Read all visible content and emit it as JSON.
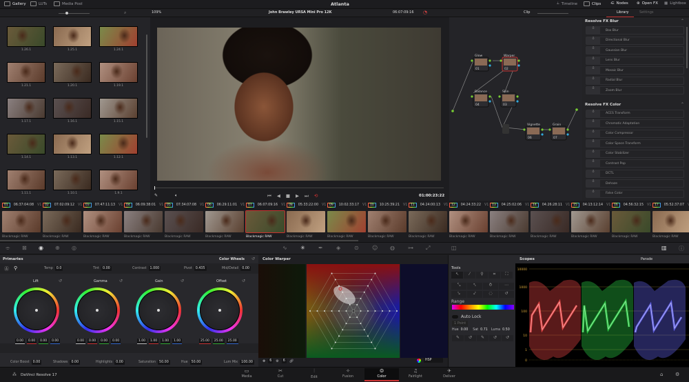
{
  "app": {
    "project_title": "Atlanta",
    "version_label": "DaVinci Resolve 17"
  },
  "top_left_tabs": [
    {
      "label": "Gallery",
      "icon": "gallery-icon",
      "active": true
    },
    {
      "label": "LUTs",
      "icon": "luts-icon"
    },
    {
      "label": "Media Pool",
      "icon": "media-pool-icon"
    }
  ],
  "top_right_tabs": [
    {
      "label": "Timeline",
      "icon": "timeline-icon"
    },
    {
      "label": "Clips",
      "icon": "clips-icon",
      "active": true
    },
    {
      "label": "Nodes",
      "icon": "nodes-icon",
      "active": true
    },
    {
      "label": "Open FX",
      "icon": "openfx-icon",
      "active": true
    },
    {
      "label": "Lightbox",
      "icon": "lightbox-icon"
    }
  ],
  "viewer": {
    "zoom": "109%",
    "clip_name": "John Brawley URSA Mini Pro 12K",
    "source_timecode": "06:07:09:16",
    "record_timecode": "01:00:23:22"
  },
  "node_editor": {
    "mode": "Clip",
    "nodes": [
      {
        "label": "Glow",
        "num": "01"
      },
      {
        "label": "Warper",
        "num": "02"
      },
      {
        "label": "Balance",
        "num": "04"
      },
      {
        "label": "Skin",
        "num": "03"
      },
      {
        "label": "Vignette",
        "num": "06"
      },
      {
        "label": "Grain",
        "num": "07"
      }
    ]
  },
  "library": {
    "tabs": [
      "Library",
      "Settings"
    ],
    "active_tab": "Library",
    "groups": [
      {
        "title": "Resolve FX Blur",
        "items": [
          "Box Blur",
          "Directional Blur",
          "Gaussian Blur",
          "Lens Blur",
          "Mosaic Blur",
          "Radial Blur",
          "Zoom Blur"
        ]
      },
      {
        "title": "Resolve FX Color",
        "items": [
          "ACES Transform",
          "Chromatic Adaptation",
          "Color Compressor",
          "Color Space Transform",
          "Color Stabilizer",
          "Contrast Pop",
          "DCTL",
          "Dehaze",
          "False Color"
        ]
      }
    ]
  },
  "gallery": {
    "stills": [
      "1.26.1",
      "1.25.1",
      "1.24.1",
      "1.21.1",
      "1.20.1",
      "1.19.1",
      "1.17.1",
      "1.16.1",
      "1.15.1",
      "1.14.1",
      "1.13.1",
      "1.12.1",
      "1.11.1",
      "1.10.1",
      "1.9.1"
    ]
  },
  "clips": {
    "track": "V1",
    "codec": "Blackmagic RAW",
    "selected": "07",
    "items": [
      {
        "num": "01",
        "tc": "06:37:04:08"
      },
      {
        "num": "02",
        "tc": "07:02:09:12"
      },
      {
        "num": "03",
        "tc": "07:47:11:13"
      },
      {
        "num": "04",
        "tc": "06:09:38:01"
      },
      {
        "num": "05",
        "tc": "07:34:07:08"
      },
      {
        "num": "06",
        "tc": "06:29:11:01"
      },
      {
        "num": "07",
        "tc": "06:07:09:16"
      },
      {
        "num": "08",
        "tc": "05:33:22:00"
      },
      {
        "num": "09",
        "tc": "10:02:33:17"
      },
      {
        "num": "10",
        "tc": "10:25:39:21"
      },
      {
        "num": "11",
        "tc": "04:24:00:13"
      },
      {
        "num": "12",
        "tc": "04:24:33:22"
      },
      {
        "num": "13",
        "tc": "04:25:02:06"
      },
      {
        "num": "14",
        "tc": "04:26:28:11"
      },
      {
        "num": "15",
        "tc": "04:13:12:14"
      },
      {
        "num": "16",
        "tc": "04:56:32:15"
      },
      {
        "num": "17",
        "tc": "05:52:37:07"
      }
    ]
  },
  "primaries": {
    "title": "Primaries",
    "mode": "Color Wheels",
    "top_params": [
      {
        "label": "Temp",
        "value": "0.0"
      },
      {
        "label": "Tint",
        "value": "0.00"
      },
      {
        "label": "Contrast",
        "value": "1.000"
      },
      {
        "label": "Pivot",
        "value": "0.435"
      },
      {
        "label": "Mid/Detail",
        "value": "0.00"
      }
    ],
    "wheels": [
      {
        "label": "Lift",
        "values": [
          "0.00",
          "0.00",
          "0.00",
          "0.00"
        ]
      },
      {
        "label": "Gamma",
        "values": [
          "0.00",
          "0.00",
          "0.00",
          "0.00"
        ]
      },
      {
        "label": "Gain",
        "values": [
          "1.00",
          "1.00",
          "1.00",
          "1.00"
        ]
      },
      {
        "label": "Offset",
        "values": [
          "25.00",
          "25.00",
          "25.00"
        ]
      }
    ],
    "bottom_params": [
      {
        "label": "Color Boost",
        "value": "0.00"
      },
      {
        "label": "Shadows",
        "value": "0.00"
      },
      {
        "label": "Highlights",
        "value": "0.00"
      },
      {
        "label": "Saturation",
        "value": "50.00"
      },
      {
        "label": "Hue",
        "value": "50.00"
      },
      {
        "label": "Lum Mix",
        "value": "100.00"
      }
    ]
  },
  "color_warper": {
    "title": "Color Warper",
    "grid_a": "6",
    "grid_b": "6",
    "space": "HSP"
  },
  "tools": {
    "title": "Tools",
    "range_label": "Range",
    "auto_lock": "Auto Lock",
    "point_mode": "1 Point",
    "hue": "0.00",
    "sat": "0.71",
    "luma": "0.50",
    "hue_label": "Hue",
    "sat_label": "Sat",
    "luma_label": "Luma"
  },
  "scopes": {
    "title": "Scopes",
    "mode": "Parade",
    "scale": [
      "10000",
      "1000",
      "100",
      "10",
      "1",
      "0"
    ],
    "colors": {
      "red": "#ff4a4a",
      "green": "#2ee04a",
      "blue": "#6a6aff"
    }
  },
  "pages": [
    {
      "label": "Media",
      "icon": "media-icon"
    },
    {
      "label": "Cut",
      "icon": "cut-icon"
    },
    {
      "label": "Edit",
      "icon": "edit-icon"
    },
    {
      "label": "Fusion",
      "icon": "fusion-icon"
    },
    {
      "label": "Color",
      "icon": "color-icon",
      "active": true
    },
    {
      "label": "Fairlight",
      "icon": "fairlight-icon"
    },
    {
      "label": "Deliver",
      "icon": "deliver-icon"
    }
  ],
  "accent": "#c8322f"
}
